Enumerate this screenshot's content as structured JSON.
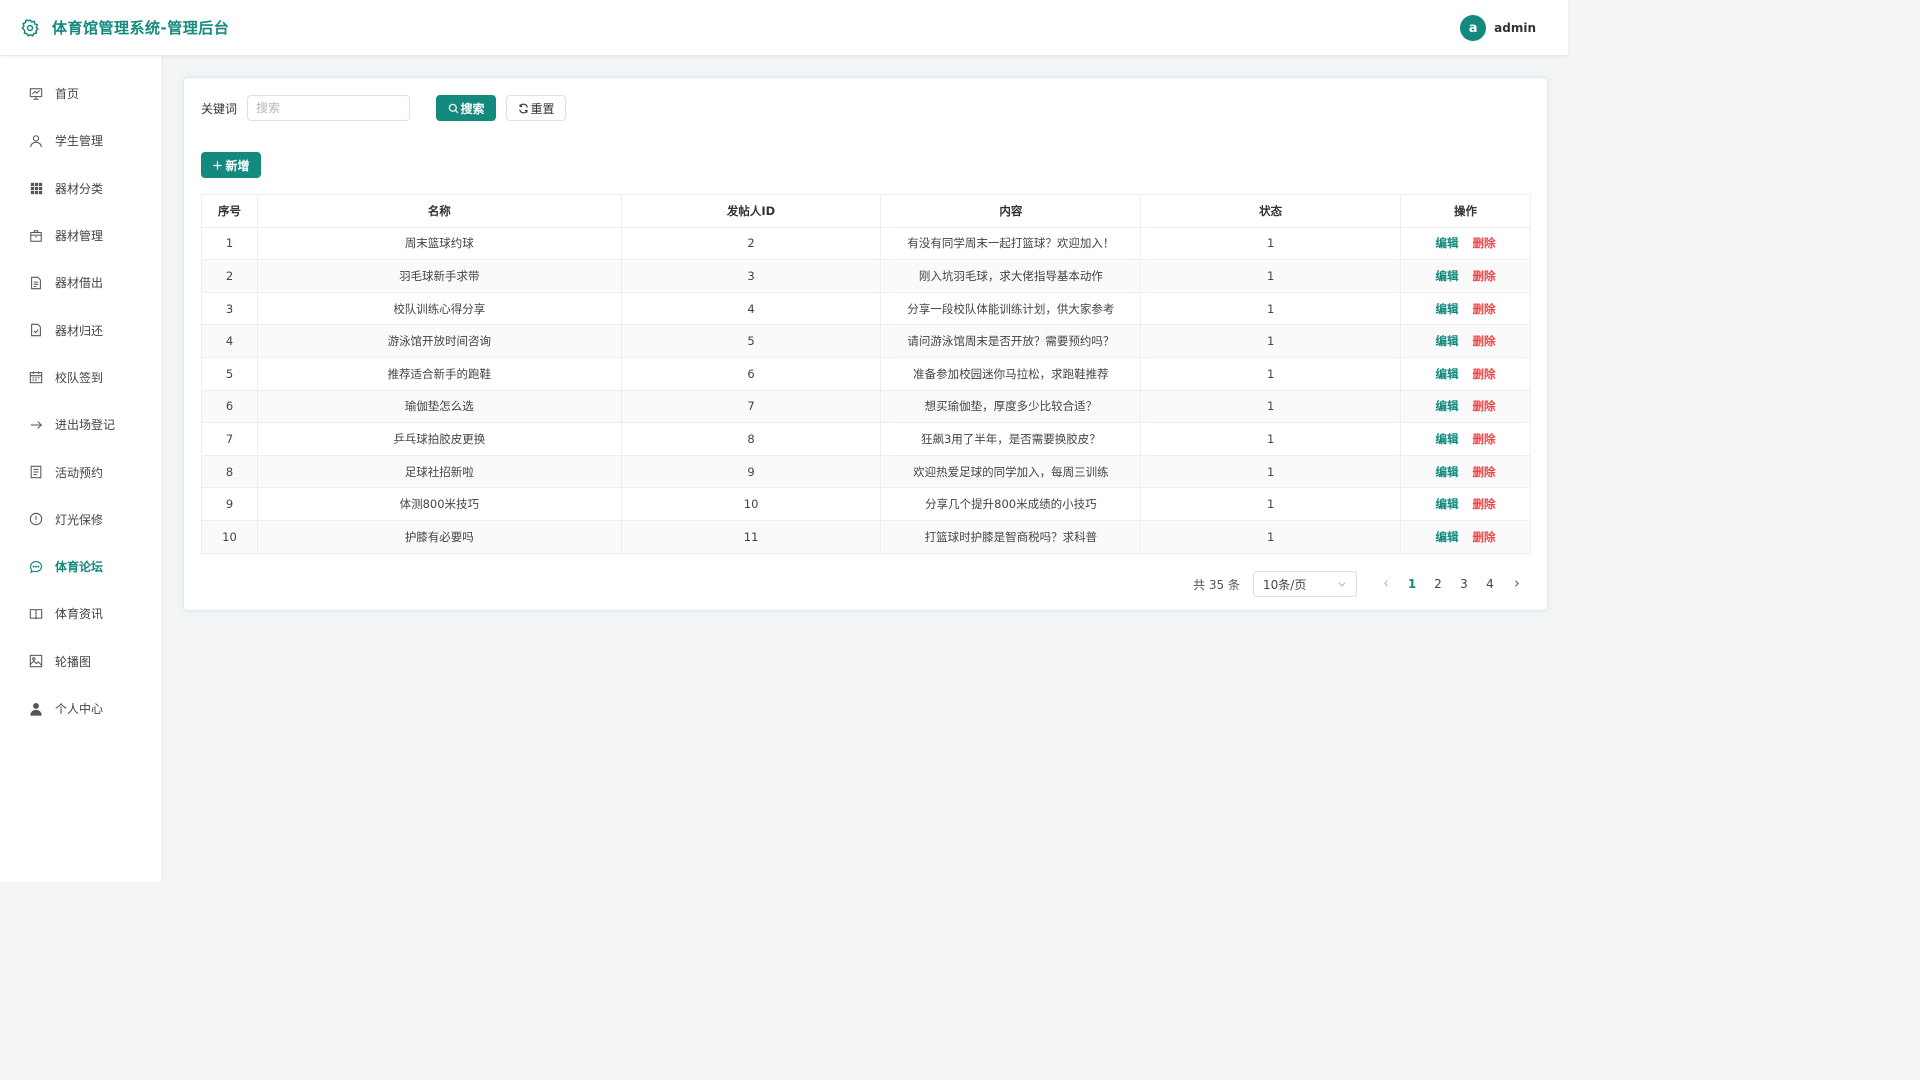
{
  "header": {
    "title": "体育馆管理系统-管理后台",
    "avatar_letter": "a",
    "username": "admin"
  },
  "colors": {
    "accent": "#14897d",
    "danger": "#f0464b"
  },
  "sidebar": {
    "active_index": 10,
    "items": [
      {
        "label": "首页",
        "icon": "presentation-icon"
      },
      {
        "label": "学生管理",
        "icon": "user-icon"
      },
      {
        "label": "器材分类",
        "icon": "grid-icon"
      },
      {
        "label": "器材管理",
        "icon": "box-icon"
      },
      {
        "label": "器材借出",
        "icon": "document-icon"
      },
      {
        "label": "器材归还",
        "icon": "document-check-icon"
      },
      {
        "label": "校队签到",
        "icon": "calendar-icon"
      },
      {
        "label": "进出场登记",
        "icon": "arrow-right-icon"
      },
      {
        "label": "活动预约",
        "icon": "list-document-icon"
      },
      {
        "label": "灯光保修",
        "icon": "info-circle-icon"
      },
      {
        "label": "体育论坛",
        "icon": "chat-icon"
      },
      {
        "label": "体育资讯",
        "icon": "book-icon"
      },
      {
        "label": "轮播图",
        "icon": "image-icon"
      },
      {
        "label": "个人中心",
        "icon": "person-filled-icon"
      }
    ]
  },
  "search": {
    "label": "关键词",
    "placeholder": "搜索",
    "search_label": "搜索",
    "reset_label": "重置",
    "add_label": "新增"
  },
  "table": {
    "columns": [
      "序号",
      "名称",
      "发帖人ID",
      "内容",
      "状态",
      "操作"
    ],
    "edit_label": "编辑",
    "delete_label": "删除",
    "rows": [
      [
        "1",
        "周末篮球约球",
        "2",
        "有没有同学周末一起打篮球？欢迎加入！",
        "1"
      ],
      [
        "2",
        "羽毛球新手求带",
        "3",
        "刚入坑羽毛球，求大佬指导基本动作",
        "1"
      ],
      [
        "3",
        "校队训练心得分享",
        "4",
        "分享一段校队体能训练计划，供大家参考",
        "1"
      ],
      [
        "4",
        "游泳馆开放时间咨询",
        "5",
        "请问游泳馆周末是否开放？需要预约吗？",
        "1"
      ],
      [
        "5",
        "推荐适合新手的跑鞋",
        "6",
        "准备参加校园迷你马拉松，求跑鞋推荐",
        "1"
      ],
      [
        "6",
        "瑜伽垫怎么选",
        "7",
        "想买瑜伽垫，厚度多少比较合适？",
        "1"
      ],
      [
        "7",
        "乒乓球拍胶皮更换",
        "8",
        "狂飙3用了半年，是否需要换胶皮？",
        "1"
      ],
      [
        "8",
        "足球社招新啦",
        "9",
        "欢迎热爱足球的同学加入，每周三训练",
        "1"
      ],
      [
        "9",
        "体测800米技巧",
        "10",
        "分享几个提升800米成绩的小技巧",
        "1"
      ],
      [
        "10",
        "护膝有必要吗",
        "11",
        "打篮球时护膝是智商税吗？求科普",
        "1"
      ]
    ]
  },
  "pagination": {
    "total_text": "共 35 条",
    "page_size": "10条/页",
    "pages": [
      "1",
      "2",
      "3",
      "4"
    ],
    "current": "1"
  }
}
